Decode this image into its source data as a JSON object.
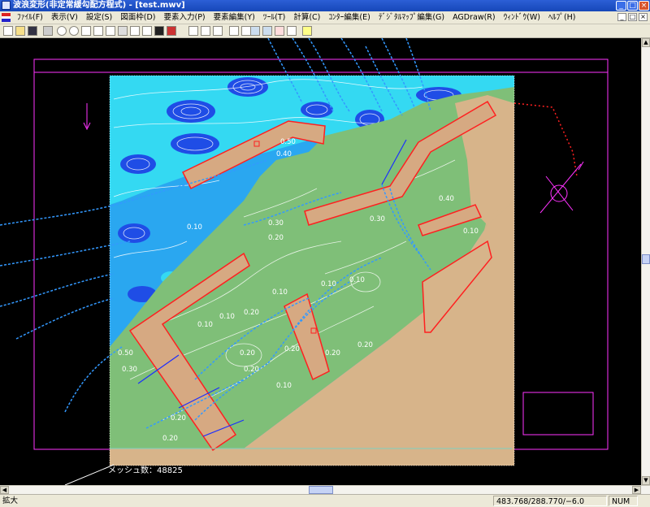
{
  "window": {
    "title": "波浪変形(非定常緩勾配方程式) - [test.mwv]"
  },
  "caption_buttons": {
    "minimize": "_",
    "maximize": "□",
    "close": "×"
  },
  "menu": {
    "items": [
      "ﾌｧｲﾙ(F)",
      "表示(V)",
      "設定(S)",
      "図面枠(D)",
      "要素入力(P)",
      "要素編集(Y)",
      "ﾂｰﾙ(T)",
      "計算(C)",
      "ｺﾝﾀｰ編集(E)",
      "ﾃﾞｼﾞﾀﾙﾏｯﾌﾟ編集(G)",
      "AGDraw(R)",
      "ｳｨﾝﾄﾞｳ(W)",
      "ﾍﾙﾌﾟ(H)"
    ],
    "mdi_controls": [
      "_",
      "□",
      "×"
    ]
  },
  "toolbar": {
    "icons": [
      "new-file-icon",
      "open-folder-icon",
      "save-icon",
      "print-icon",
      "zoom-in-icon",
      "zoom-out-icon",
      "fit-all-icon",
      "zoom-window-icon",
      "zoom-previous-icon",
      "redraw-icon",
      "grid-icon",
      "element-icon",
      "scale-bar-icon",
      "image-icon",
      "chart-icon",
      "mesh-icon",
      "node-icon",
      "point-icon",
      "coordinate-icon",
      "layer-icon",
      "contour-icon",
      "vector-icon",
      "text-icon",
      "map-icon",
      "help-icon"
    ]
  },
  "canvas": {
    "mesh_label": "メッシュ数：48825",
    "contour_labels": [
      "0.50",
      "0.40",
      "0.30",
      "0.20",
      "0.10",
      "0.10",
      "0.10",
      "0.30",
      "0.40",
      "0.10",
      "0.10",
      "0.20",
      "0.10",
      "0.20",
      "0.20",
      "0.20",
      "0.10",
      "0.20",
      "0.20",
      "0.20",
      "0.50",
      "0.10",
      "0.30",
      "0.20"
    ],
    "colors": {
      "sea_deep": "#1f4de6",
      "sea_mid": "#2aa7f0",
      "sea_light": "#34d9f2",
      "harbor_calm": "#7fbf78",
      "land": "#d7b48a",
      "breakwater": "#d6a982",
      "frame": "#ff33ff",
      "node_line": "#3399ff",
      "node_red": "#ff2020"
    }
  },
  "statusbar": {
    "mode": "拡大",
    "coordinates": "483.768/288.770/−6.0",
    "num": "NUM"
  }
}
